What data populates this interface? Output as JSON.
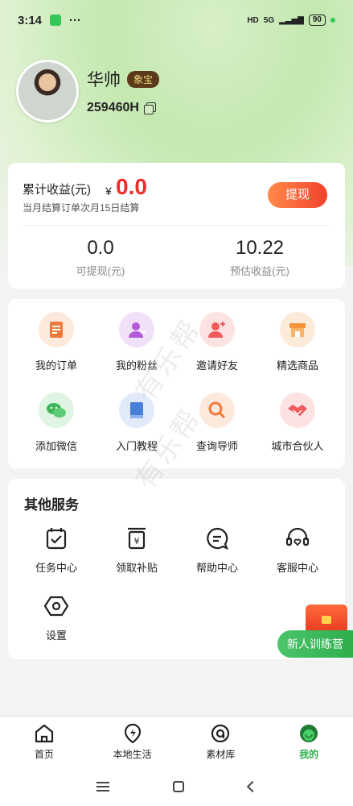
{
  "status_bar": {
    "time": "3:14",
    "dots": "···",
    "hd": "HD",
    "network": "5G",
    "battery": "90"
  },
  "profile": {
    "name": "华帅",
    "badge": "象宝",
    "uid": "259460H"
  },
  "earnings": {
    "title": "累计收益(元)",
    "currency": "¥",
    "amount": "0.0",
    "subtitle": "当月结算订单次月15日结算",
    "withdraw_button": "提现",
    "withdrawable_value": "0.0",
    "withdrawable_label": "可提现(元)",
    "estimated_value": "10.22",
    "estimated_label": "预估收益(元)"
  },
  "menu": [
    {
      "label": "我的订单",
      "icon": "order-icon",
      "color": "#f07a3a",
      "bg": "#fde8dc"
    },
    {
      "label": "我的粉丝",
      "icon": "fans-icon",
      "color": "#b25ad8",
      "bg": "#f1e1f8"
    },
    {
      "label": "邀请好友",
      "icon": "invite-friend-icon",
      "color": "#f05a5a",
      "bg": "#fde2e2"
    },
    {
      "label": "精选商品",
      "icon": "store-icon",
      "color": "#f5943a",
      "bg": "#fdebd9"
    },
    {
      "label": "添加微信",
      "icon": "wechat-icon",
      "color": "#3fb65a",
      "bg": "#e0f4e3"
    },
    {
      "label": "入门教程",
      "icon": "book-icon",
      "color": "#4a7fd8",
      "bg": "#e1eaf9"
    },
    {
      "label": "查询导师",
      "icon": "search-icon",
      "color": "#f07a3a",
      "bg": "#fde8dc"
    },
    {
      "label": "城市合伙人",
      "icon": "handshake-icon",
      "color": "#f05a5a",
      "bg": "#fde2e2"
    }
  ],
  "services": {
    "title": "其他服务",
    "items": [
      {
        "label": "任务中心",
        "icon": "task-icon"
      },
      {
        "label": "领取补贴",
        "icon": "subsidy-icon"
      },
      {
        "label": "帮助中心",
        "icon": "help-icon"
      },
      {
        "label": "客服中心",
        "icon": "customer-service-icon"
      },
      {
        "label": "设置",
        "icon": "settings-icon"
      }
    ]
  },
  "floating": {
    "trainee_button": "新人训练营"
  },
  "watermark": "有乐帮",
  "tabs": [
    {
      "label": "首页",
      "icon": "home-icon"
    },
    {
      "label": "本地生活",
      "icon": "local-life-icon"
    },
    {
      "label": "素材库",
      "icon": "material-icon"
    },
    {
      "label": "我的",
      "icon": "profile-icon"
    }
  ],
  "active_tab": "我的",
  "accent_color": "#2fae4e"
}
